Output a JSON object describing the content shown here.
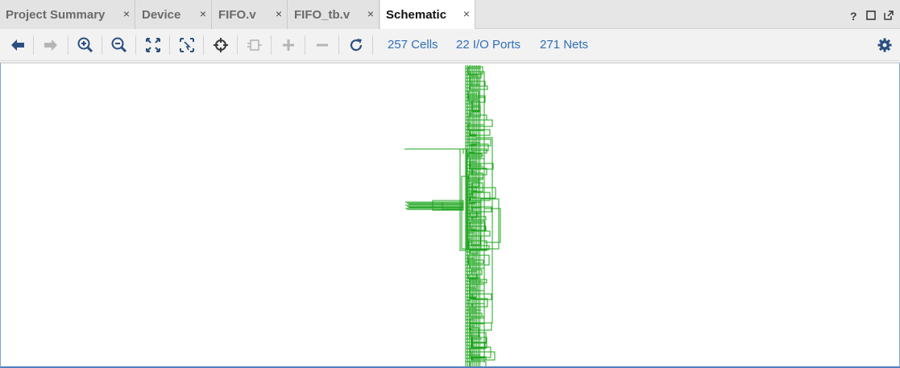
{
  "tabs": [
    {
      "label": "Project Summary",
      "close": "×",
      "active": false
    },
    {
      "label": "Device",
      "close": "×",
      "active": false
    },
    {
      "label": "FIFO.v",
      "close": "×",
      "active": false
    },
    {
      "label": "FIFO_tb.v",
      "close": "×",
      "active": false
    },
    {
      "label": "Schematic",
      "close": "×",
      "active": true
    }
  ],
  "window_controls": [
    "help-icon",
    "maximize-icon",
    "float-icon"
  ],
  "toolbar": {
    "buttons": [
      {
        "icon": "back-arrow-icon",
        "enabled": true
      },
      {
        "icon": "forward-arrow-icon",
        "enabled": false
      },
      {
        "icon": "zoom-in-icon",
        "enabled": true
      },
      {
        "icon": "zoom-out-icon",
        "enabled": true
      },
      {
        "icon": "zoom-fit-icon",
        "enabled": true
      },
      {
        "icon": "zoom-area-icon",
        "enabled": true
      },
      {
        "icon": "crosshair-icon",
        "enabled": true
      },
      {
        "icon": "cell-icon",
        "enabled": false
      },
      {
        "icon": "expand-plus-icon",
        "enabled": false
      },
      {
        "icon": "collapse-minus-icon",
        "enabled": false
      },
      {
        "icon": "refresh-icon",
        "enabled": true
      }
    ],
    "stats": {
      "cells": "257 Cells",
      "io_ports": "22 I/O Ports",
      "nets": "271 Nets"
    },
    "settings_icon": "gear-icon"
  },
  "colors": {
    "net_green": "#1ea51e",
    "link_blue": "#2f6fb8",
    "icon_dark": "#3b3b3b",
    "icon_disabled": "#b5b5b5",
    "accent_blue": "#2a5fa6"
  }
}
